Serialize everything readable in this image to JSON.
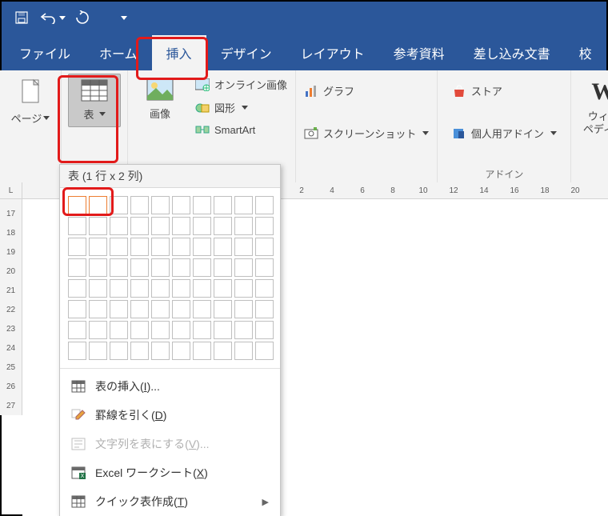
{
  "qat": {
    "save": "save",
    "undo": "undo",
    "redo": "redo"
  },
  "tabs": [
    {
      "id": "file",
      "label": "ファイル"
    },
    {
      "id": "home",
      "label": "ホーム"
    },
    {
      "id": "insert",
      "label": "挿入",
      "active": true
    },
    {
      "id": "design",
      "label": "デザイン"
    },
    {
      "id": "layout",
      "label": "レイアウト"
    },
    {
      "id": "references",
      "label": "参考資料"
    },
    {
      "id": "mailings",
      "label": "差し込み文書"
    },
    {
      "id": "review",
      "label": "校"
    }
  ],
  "ribbon": {
    "page_btn": "ページ",
    "table_btn": "表",
    "pictures_btn": "画像",
    "online_pictures": "オンライン画像",
    "shapes": "図形",
    "smartart": "SmartArt",
    "chart": "グラフ",
    "screenshot": "スクリーンショット",
    "store": "ストア",
    "my_addins": "個人用アドイン",
    "addins_group": "アドイン",
    "wiki": "ウィキ\nペディア",
    "wiki_letter": "W"
  },
  "dropdown": {
    "title": "表 (1 行 x 2 列)",
    "rows": 8,
    "cols": 10,
    "sel_rows": 1,
    "sel_cols": 2,
    "menu": [
      {
        "id": "insert",
        "label": "表の挿入",
        "accel": "I",
        "suffix": "...",
        "icon": "table"
      },
      {
        "id": "draw",
        "label": "罫線を引く",
        "accel": "D",
        "icon": "pencil"
      },
      {
        "id": "convert",
        "label": "文字列を表にする",
        "accel": "V",
        "suffix": "...",
        "icon": "convert",
        "disabled": true
      },
      {
        "id": "excel",
        "label": "Excel ワークシート",
        "accel": "X",
        "icon": "excel"
      },
      {
        "id": "quick",
        "label": "クイック表作成",
        "accel": "T",
        "icon": "table",
        "arrow": true
      }
    ]
  },
  "hruler": [
    2,
    4,
    6,
    8,
    10,
    12,
    14,
    16,
    18,
    20
  ],
  "vruler": [
    17,
    18,
    19,
    20,
    21,
    22,
    23,
    24,
    25,
    26,
    27
  ],
  "corner_label": "L"
}
